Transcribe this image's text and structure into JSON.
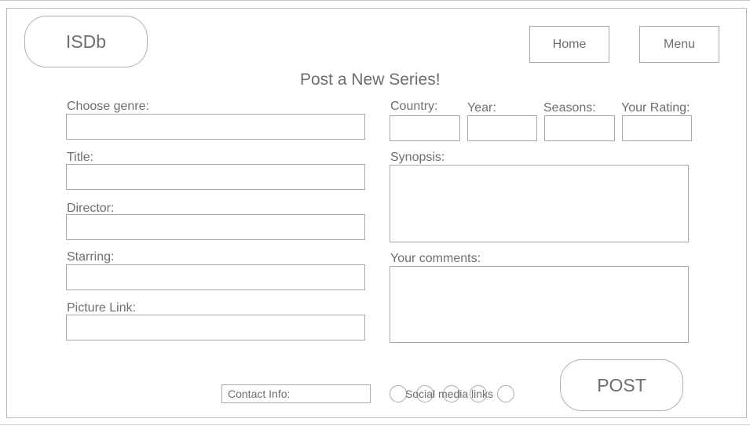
{
  "header": {
    "logo": "ISDb",
    "nav": {
      "home": "Home",
      "menu": "Menu"
    }
  },
  "page_title": "Post a New Series!",
  "form": {
    "genre_label": "Choose genre:",
    "title_label": "Title:",
    "director_label": "Director:",
    "starring_label": "Starring:",
    "picture_label": "Picture Link:",
    "country_label": "Country:",
    "year_label": "Year:",
    "seasons_label": "Seasons:",
    "rating_label": "Your Rating:",
    "synopsis_label": "Synopsis:",
    "comments_label": "Your comments:",
    "post_label": "POST"
  },
  "footer": {
    "contact_label": "Contact Info:",
    "social_label": "Social media links"
  }
}
